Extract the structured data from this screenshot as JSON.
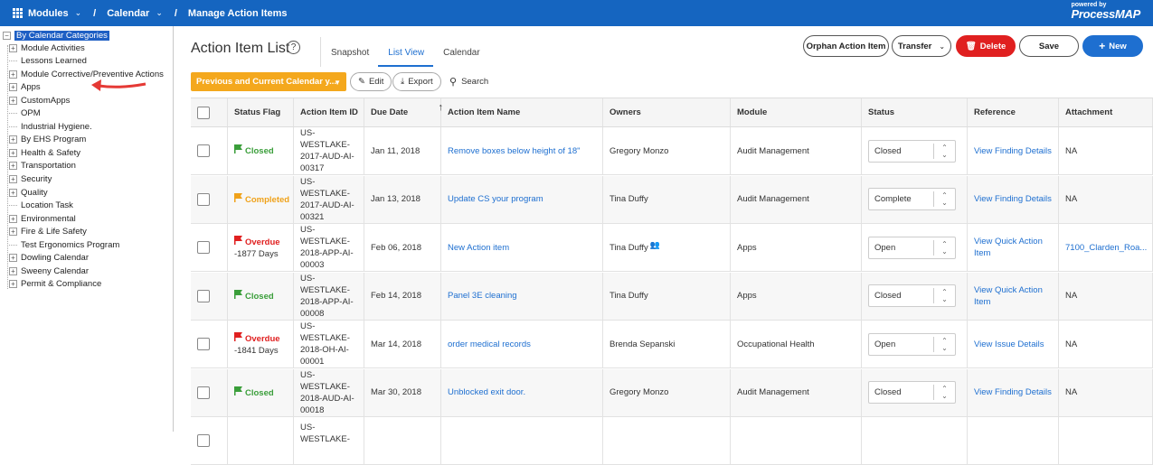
{
  "topbar": {
    "crumb1": "Modules",
    "crumb2": "Calendar",
    "crumb3": "Manage Action Items",
    "brand_powered": "powered by",
    "brand_process": "Process",
    "brand_map": "MAP"
  },
  "tree": {
    "root": "By Calendar Categories",
    "items": [
      {
        "label": "Module Activities",
        "expandable": true
      },
      {
        "label": "Lessons Learned",
        "expandable": false
      },
      {
        "label": "Module Corrective/Preventive Actions",
        "expandable": true
      },
      {
        "label": "Apps",
        "expandable": true
      },
      {
        "label": "CustomApps",
        "expandable": true
      },
      {
        "label": "OPM",
        "expandable": false
      },
      {
        "label": "Industrial Hygiene.",
        "expandable": false
      },
      {
        "label": "By EHS Program",
        "expandable": true
      },
      {
        "label": "Health & Safety",
        "expandable": true
      },
      {
        "label": "Transportation",
        "expandable": true
      },
      {
        "label": "Security",
        "expandable": true
      },
      {
        "label": "Quality",
        "expandable": true
      },
      {
        "label": "Location Task",
        "expandable": false
      },
      {
        "label": "Environmental",
        "expandable": true
      },
      {
        "label": "Fire & Life Safety",
        "expandable": true
      },
      {
        "label": "Test Ergonomics Program",
        "expandable": false
      },
      {
        "label": "Dowling Calendar",
        "expandable": true
      },
      {
        "label": "Sweeny Calendar",
        "expandable": true
      },
      {
        "label": "Permit & Compliance",
        "expandable": true
      }
    ]
  },
  "main": {
    "title": "Action Item List",
    "help": "?",
    "tabs": [
      "Snapshot",
      "List View",
      "Calendar"
    ],
    "buttons": {
      "orphan": "Orphan Action Item",
      "transfer": "Transfer",
      "delete": "Delete",
      "save": "Save",
      "new": "New"
    },
    "filter": "Previous and Current Calendar y...",
    "edit": "Edit",
    "export": "Export",
    "search": "Search"
  },
  "table": {
    "headers": [
      "Status Flag",
      "Action Item ID",
      "Due Date",
      "Action Item Name",
      "Owners",
      "Module",
      "Status",
      "Reference",
      "Attachment"
    ],
    "rows": [
      {
        "flag": "Closed",
        "flag_type": "closed",
        "days": "",
        "id": "US-WESTLAKE-\n2017-AUD-AI-\n00317",
        "due": "Jan 11, 2018",
        "name": "Remove boxes below height of 18\"",
        "owner": "Gregory Monzo",
        "module": "Audit Management",
        "status": "Closed",
        "reference": "View Finding Details",
        "attachment": "NA"
      },
      {
        "flag": "Completed",
        "flag_type": "completed",
        "days": "",
        "id": "US-WESTLAKE-\n2017-AUD-AI-\n00321",
        "due": "Jan 13, 2018",
        "name": "Update CS your program",
        "owner": "Tina Duffy",
        "module": "Audit Management",
        "status": "Complete",
        "reference": "View Finding Details",
        "attachment": "NA"
      },
      {
        "flag": "Overdue",
        "flag_type": "overdue",
        "days": "-1877 Days",
        "id": "US-WESTLAKE-\n2018-APP-AI-\n00003",
        "due": "Feb 06, 2018",
        "name": "New Action item",
        "owner": "Tina Duffy",
        "module": "Apps",
        "status": "Open",
        "reference": "View Quick Action\nItem",
        "attachment": "7100_Clarden_Roa..."
      },
      {
        "flag": "Closed",
        "flag_type": "closed",
        "days": "",
        "id": "US-WESTLAKE-\n2018-APP-AI-\n00008",
        "due": "Feb 14, 2018",
        "name": "Panel 3E cleaning",
        "owner": "Tina Duffy",
        "module": "Apps",
        "status": "Closed",
        "reference": "View Quick Action\nItem",
        "attachment": "NA"
      },
      {
        "flag": "Overdue",
        "flag_type": "overdue",
        "days": "-1841 Days",
        "id": "US-WESTLAKE-\n2018-OH-AI-\n00001",
        "due": "Mar 14, 2018",
        "name": "order medical records",
        "owner": "Brenda Sepanski",
        "module": "Occupational Health",
        "status": "Open",
        "reference": "View Issue Details",
        "attachment": "NA"
      },
      {
        "flag": "Closed",
        "flag_type": "closed",
        "days": "",
        "id": "US-WESTLAKE-\n2018-AUD-AI-\n00018",
        "due": "Mar 30, 2018",
        "name": "Unblocked exit door.",
        "owner": "Gregory Monzo",
        "module": "Audit Management",
        "status": "Closed",
        "reference": "View Finding Details",
        "attachment": "NA"
      },
      {
        "flag": "",
        "flag_type": "",
        "days": "",
        "id": "US-WESTLAKE-",
        "due": "",
        "name": "",
        "owner": "",
        "module": "",
        "status": "",
        "reference": "",
        "attachment": ""
      }
    ]
  },
  "colors": {
    "primary": "#1565c0",
    "accent": "#1e6fd0",
    "delete": "#e02020",
    "filter": "#f4a81d",
    "closed": "#3a9e3a",
    "completed": "#f0a21a",
    "overdue": "#e02020"
  }
}
